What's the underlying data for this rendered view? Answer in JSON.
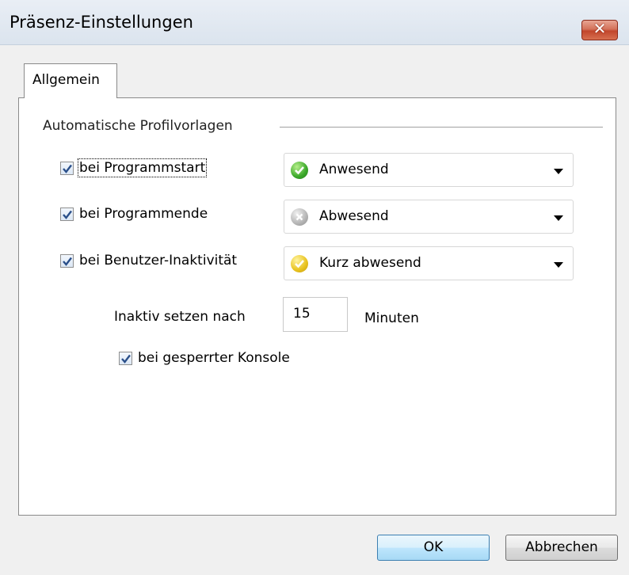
{
  "window": {
    "title": "Präsenz-Einstellungen",
    "close_label": "✕"
  },
  "tabs": [
    {
      "label": "Allgemein",
      "selected": true
    }
  ],
  "group": {
    "label": "Automatische Profilvorlagen"
  },
  "rules": [
    {
      "label": "bei Programmstart",
      "checked": true,
      "status": "Anwesend",
      "status_icon": "green-check-icon"
    },
    {
      "label": "bei Programmende",
      "checked": true,
      "status": "Abwesend",
      "status_icon": "gray-x-icon"
    },
    {
      "label": "bei Benutzer-Inaktivität",
      "checked": true,
      "status": "Kurz abwesend",
      "status_icon": "yellow-check-icon"
    }
  ],
  "inactivity": {
    "label": "Inaktiv setzen nach",
    "value": "15",
    "unit": "Minuten"
  },
  "locked_console": {
    "label": "bei gesperrter Konsole",
    "checked": true
  },
  "buttons": {
    "ok": "OK",
    "cancel": "Abbrechen"
  },
  "colors": {
    "accent_blue": "#3c7fb1",
    "close_red": "#c2462c",
    "status_green": "#3aa82a",
    "status_gray": "#b5b5b5",
    "status_yellow": "#e8c21e"
  }
}
